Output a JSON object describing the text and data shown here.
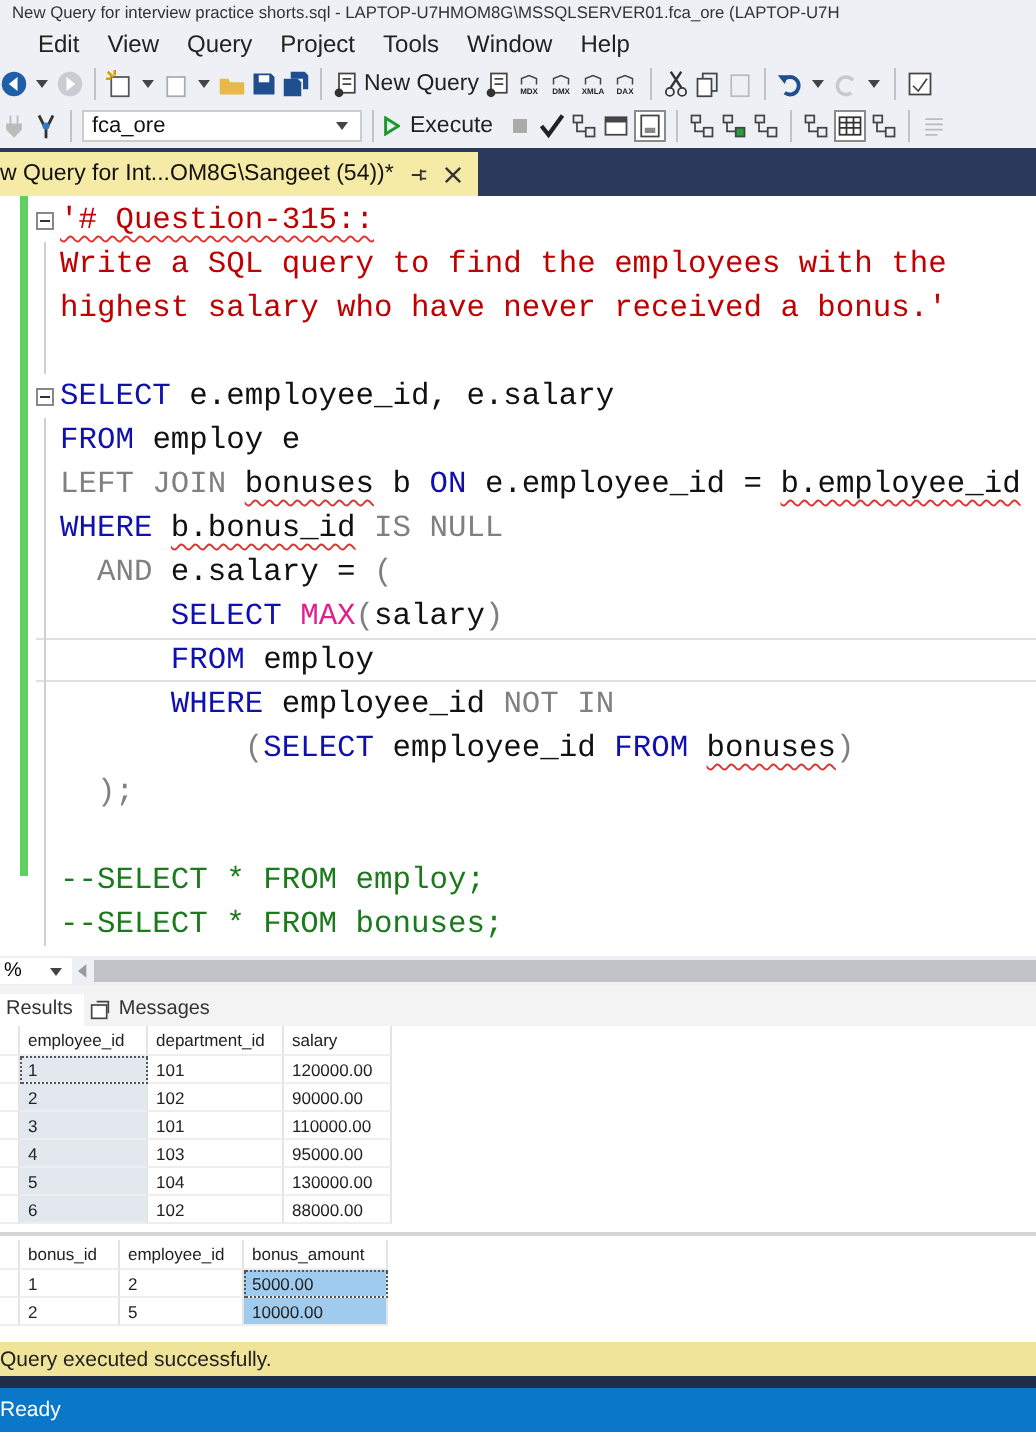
{
  "window": {
    "title": "New Query for interview practice shorts.sql - LAPTOP-U7HMOM8G\\MSSQLSERVER01.fca_ore (LAPTOP-U7H"
  },
  "menu": [
    "Edit",
    "View",
    "Query",
    "Project",
    "Tools",
    "Window",
    "Help"
  ],
  "toolbar": {
    "new_query": "New Query",
    "icon_captions": [
      "MDX",
      "DMX",
      "XMLA",
      "DAX"
    ],
    "database": "fca_ore",
    "execute": "Execute"
  },
  "tab": {
    "title": "w Query for Int...OM8G\\Sangeet (54))*",
    "selected": true
  },
  "editor": {
    "lines": [
      {
        "fold": true,
        "current": false,
        "segments": [
          {
            "t": "'# Question-315::",
            "kind": "string",
            "squiggle": true
          }
        ]
      },
      {
        "fold": false,
        "current": false,
        "segments": [
          {
            "t": "Write a SQL query to find the employees with the",
            "kind": "string"
          }
        ]
      },
      {
        "fold": false,
        "current": false,
        "segments": [
          {
            "t": "highest salary who have never received a bonus.'",
            "kind": "string"
          }
        ]
      },
      {
        "fold": false,
        "current": false
      },
      {
        "fold": true,
        "current": false,
        "segments": [
          {
            "t": "SELECT",
            "kind": "keyword"
          },
          {
            "t": " e.employee_id, e.salary",
            "kind": "plain"
          }
        ]
      },
      {
        "fold": false,
        "current": false,
        "segments": [
          {
            "t": "FROM",
            "kind": "keyword"
          },
          {
            "t": " employ e",
            "kind": "plain"
          }
        ]
      },
      {
        "fold": false,
        "current": false,
        "segments": [
          {
            "t": "LEFT JOIN ",
            "kind": "operator"
          },
          {
            "t": "bonuses",
            "kind": "plain",
            "squiggle": true
          },
          {
            "t": " b ",
            "kind": "plain"
          },
          {
            "t": "ON",
            "kind": "keyword"
          },
          {
            "t": " e.employee_id = ",
            "kind": "plain"
          },
          {
            "t": "b.employee_id",
            "kind": "plain",
            "squiggle": true
          }
        ]
      },
      {
        "fold": false,
        "current": false,
        "segments": [
          {
            "t": "WHERE ",
            "kind": "keyword"
          },
          {
            "t": "b.bonus_id",
            "kind": "plain",
            "squiggle": true
          },
          {
            "t": " IS NULL",
            "kind": "operator"
          }
        ]
      },
      {
        "fold": false,
        "current": false,
        "segments": [
          {
            "t": "  AND",
            "kind": "operator"
          },
          {
            "t": " e.salary = ",
            "kind": "plain"
          },
          {
            "t": "(",
            "kind": "operator"
          }
        ]
      },
      {
        "fold": false,
        "current": false,
        "segments": [
          {
            "t": "      SELECT ",
            "kind": "keyword"
          },
          {
            "t": "MAX",
            "kind": "function"
          },
          {
            "t": "(",
            "kind": "operator"
          },
          {
            "t": "salary",
            "kind": "plain"
          },
          {
            "t": ")",
            "kind": "operator"
          }
        ]
      },
      {
        "fold": false,
        "current": true,
        "segments": [
          {
            "t": "      FROM",
            "kind": "keyword"
          },
          {
            "t": " employ",
            "kind": "plain"
          }
        ]
      },
      {
        "fold": false,
        "current": false,
        "segments": [
          {
            "t": "      WHERE",
            "kind": "keyword"
          },
          {
            "t": " employee_id ",
            "kind": "plain"
          },
          {
            "t": "NOT IN",
            "kind": "operator"
          }
        ]
      },
      {
        "fold": false,
        "current": false,
        "segments": [
          {
            "t": "          (",
            "kind": "operator"
          },
          {
            "t": "SELECT",
            "kind": "keyword"
          },
          {
            "t": " employee_id ",
            "kind": "plain"
          },
          {
            "t": "FROM ",
            "kind": "keyword"
          },
          {
            "t": "bonuses",
            "kind": "plain",
            "squiggle": true
          },
          {
            "t": ")",
            "kind": "operator"
          }
        ]
      },
      {
        "fold": false,
        "current": false,
        "segments": [
          {
            "t": "  );",
            "kind": "operator"
          }
        ]
      },
      {
        "fold": false,
        "current": false
      },
      {
        "fold": false,
        "current": false,
        "segments": [
          {
            "t": "--SELECT * FROM employ;",
            "kind": "comment"
          }
        ]
      },
      {
        "fold": false,
        "current": false,
        "segments": [
          {
            "t": "--SELECT * FROM bonuses;",
            "kind": "comment"
          }
        ]
      }
    ]
  },
  "zoom": {
    "value": "%"
  },
  "result_tabs": [
    {
      "label": "Results",
      "selected": true
    },
    {
      "label": "Messages",
      "selected": false
    }
  ],
  "grids": [
    {
      "active": false,
      "columns": [
        {
          "name": "employee_id",
          "selected": true
        },
        {
          "name": "department_id",
          "selected": false
        },
        {
          "name": "salary",
          "selected": false
        }
      ],
      "rows": [
        [
          "1",
          "101",
          "120000.00"
        ],
        [
          "2",
          "102",
          "90000.00"
        ],
        [
          "3",
          "101",
          "110000.00"
        ],
        [
          "4",
          "103",
          "95000.00"
        ],
        [
          "5",
          "104",
          "130000.00"
        ],
        [
          "6",
          "102",
          "88000.00"
        ]
      ]
    },
    {
      "active": true,
      "columns": [
        {
          "name": "bonus_id",
          "selected": false
        },
        {
          "name": "employee_id",
          "selected": false
        },
        {
          "name": "bonus_amount",
          "selected": true
        }
      ],
      "rows": [
        [
          "1",
          "2",
          "5000.00"
        ],
        [
          "2",
          "5",
          "10000.00"
        ]
      ]
    }
  ],
  "message": "Query executed successfully.",
  "status_bar": "Ready"
}
